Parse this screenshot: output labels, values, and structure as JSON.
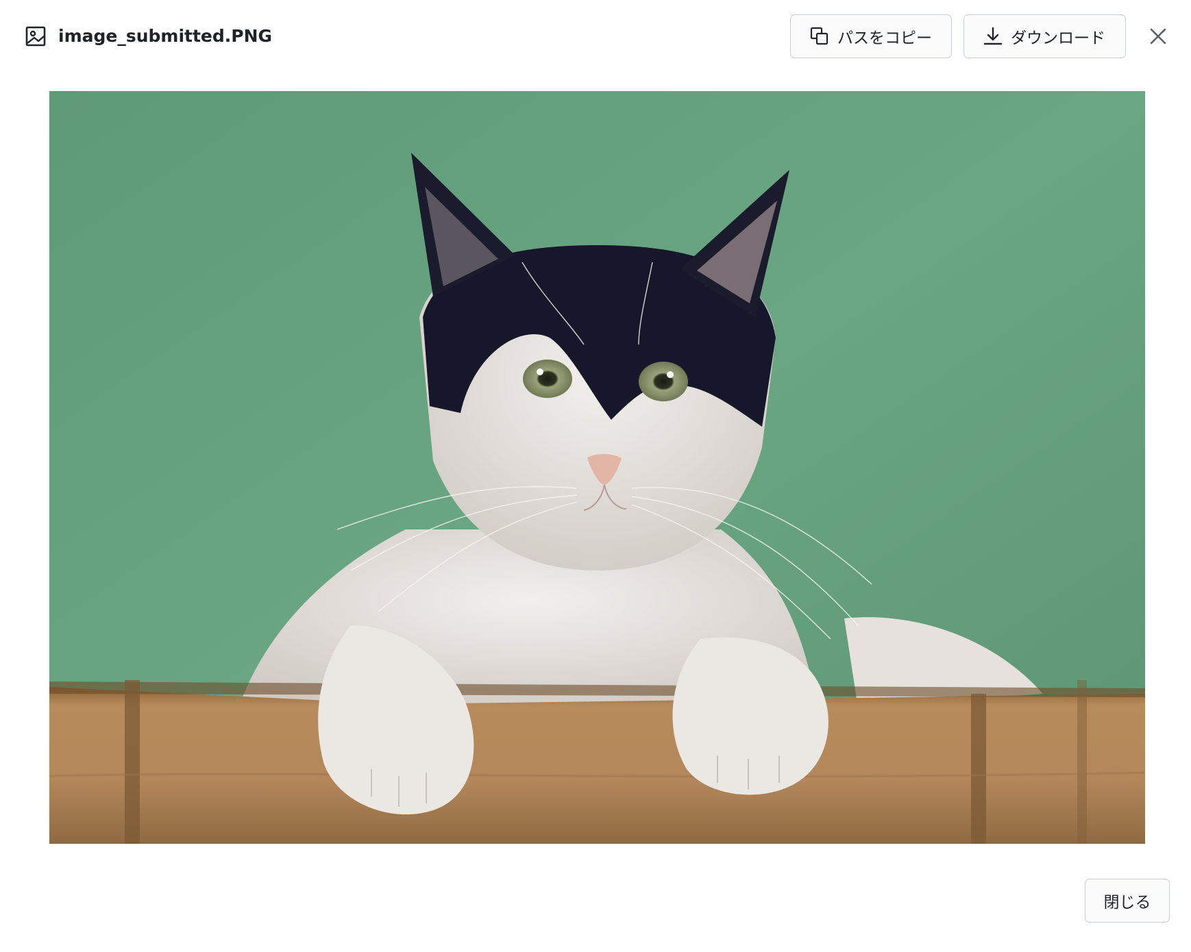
{
  "header": {
    "file_name": "image_submitted.PNG",
    "file_icon": "image-file-icon",
    "copy_path_label": "パスをコピー",
    "copy_icon": "copy-icon",
    "download_label": "ダウンロード",
    "download_icon": "download-icon",
    "close_icon": "close-icon"
  },
  "preview": {
    "image_kind": "photo-preview"
  },
  "footer": {
    "close_label": "閉じる"
  },
  "colors": {
    "border": "#c9ced6",
    "text": "#1f2328",
    "button_bg": "#fbfbfc",
    "wall": "#6aa382",
    "bamboo": "#b3875a"
  }
}
